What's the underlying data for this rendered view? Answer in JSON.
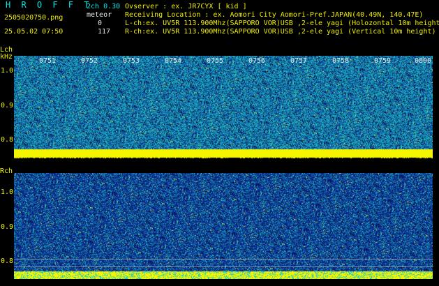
{
  "header": {
    "app_title": "H R O F F T",
    "filename": "2505020750.png",
    "datetime": "25.05.02 07:50",
    "mode": "2ch 0.30",
    "meteor_label": "meteor",
    "meteor_count": "0",
    "meteor_total": "117",
    "observer": "Ovserver           : ex. JR7CYX [ kid ]",
    "location": "Receiving Location : ex. Aomori City Aomori-Pref.JAPAN(40.49N, 140.47E)",
    "lch_info": "L-ch:ex. UV5R 113.900Mhz(SAPPORO VOR)USB ,2-ele yagi (Holozontal 10m height)",
    "rch_info": "R-ch:ex. UV5R 113.900Mhz(SAPPORO VOR)USB ,2-ele yagi (Vertical 10m height)"
  },
  "axes": {
    "lch_label": "Lch",
    "khz_label": "kHz",
    "rch_label": "Rch",
    "lch_ticks": [
      "1.0",
      "0.9",
      "0.8"
    ],
    "rch_ticks": [
      "1.0",
      "0.9",
      "0.8"
    ],
    "time_ticks": [
      "0751",
      "0752",
      "0753",
      "0754",
      "0755",
      "0756",
      "0757",
      "0758",
      "0759",
      "0800"
    ]
  },
  "colors": {
    "background": "#000000",
    "header_text": "#00e5e5",
    "label_text": "#f0f000",
    "noise_dark": "#0a1e8c",
    "noise_light": "#1ed2c8",
    "carrier": "#f5f500"
  }
}
